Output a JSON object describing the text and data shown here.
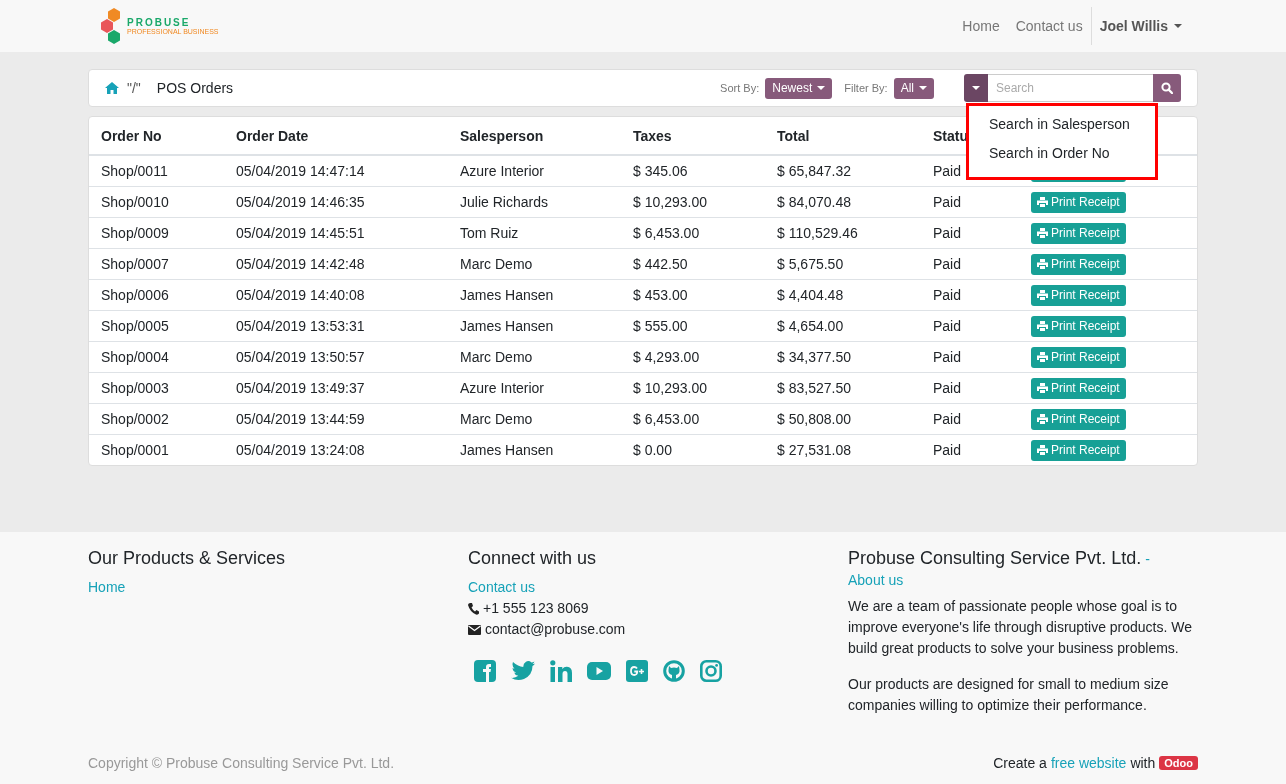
{
  "navbar": {
    "logo": {
      "name": "PROBUSE",
      "tagline": "PROFESSIONAL BUSINESS"
    },
    "links": [
      {
        "label": "Home"
      },
      {
        "label": "Contact us"
      }
    ],
    "user": "Joel Willis"
  },
  "toolbar": {
    "breadcrumb": [
      "\"/\"",
      "POS Orders"
    ],
    "sort_label": "Sort By:",
    "sort_value": "Newest",
    "filter_label": "Filter By:",
    "filter_value": "All",
    "search": {
      "placeholder": "Search"
    },
    "search_menu": {
      "expanded": true,
      "items": [
        "Search in Salesperson",
        "Search in Order No"
      ]
    }
  },
  "table": {
    "columns": [
      "Order No",
      "Order Date",
      "Salesperson",
      "Taxes",
      "Total",
      "Statu"
    ],
    "rows": [
      {
        "cells": [
          "Shop/0011",
          "05/04/2019 14:47:14",
          "Azure Interior",
          "$ 345.06",
          "$ 65,847.32",
          "Paid"
        ],
        "action": ""
      },
      {
        "cells": [
          "Shop/0010",
          "05/04/2019 14:46:35",
          "Julie Richards",
          "$ 10,293.00",
          "$ 84,070.48",
          "Paid"
        ],
        "action": "Print Receipt"
      },
      {
        "cells": [
          "Shop/0009",
          "05/04/2019 14:45:51",
          "Tom Ruiz",
          "$ 6,453.00",
          "$ 110,529.46",
          "Paid"
        ],
        "action": "Print Receipt"
      },
      {
        "cells": [
          "Shop/0007",
          "05/04/2019 14:42:48",
          "Marc Demo",
          "$ 442.50",
          "$ 5,675.50",
          "Paid"
        ],
        "action": "Print Receipt"
      },
      {
        "cells": [
          "Shop/0006",
          "05/04/2019 14:40:08",
          "James Hansen",
          "$ 453.00",
          "$ 4,404.48",
          "Paid"
        ],
        "action": "Print Receipt"
      },
      {
        "cells": [
          "Shop/0005",
          "05/04/2019 13:53:31",
          "James Hansen",
          "$ 555.00",
          "$ 4,654.00",
          "Paid"
        ],
        "action": "Print Receipt"
      },
      {
        "cells": [
          "Shop/0004",
          "05/04/2019 13:50:57",
          "Marc Demo",
          "$ 4,293.00",
          "$ 34,377.50",
          "Paid"
        ],
        "action": "Print Receipt"
      },
      {
        "cells": [
          "Shop/0003",
          "05/04/2019 13:49:37",
          "Azure Interior",
          "$ 10,293.00",
          "$ 83,527.50",
          "Paid"
        ],
        "action": "Print Receipt"
      },
      {
        "cells": [
          "Shop/0002",
          "05/04/2019 13:44:59",
          "Marc Demo",
          "$ 6,453.00",
          "$ 50,808.00",
          "Paid"
        ],
        "action": "Print Receipt"
      },
      {
        "cells": [
          "Shop/0001",
          "05/04/2019 13:24:08",
          "James Hansen",
          "$ 0.00",
          "$ 27,531.08",
          "Paid"
        ],
        "action": "Print Receipt"
      }
    ]
  },
  "footer": {
    "products": {
      "title": "Our Products & Services",
      "links": [
        "Home"
      ]
    },
    "connect": {
      "title": "Connect with us",
      "link": "Contact us",
      "phone": "+1 555 123 8069",
      "email": "contact@probuse.com"
    },
    "about": {
      "title": "Probuse Consulting Service Pvt. Ltd.",
      "dash": "-",
      "link": "About us",
      "paragraphs": [
        "We are a team of passionate people whose goal is to improve everyone's life through disruptive products. We build great products to solve your business problems.",
        "Our products are designed for small to medium size companies willing to optimize their performance."
      ]
    },
    "copyright": "Copyright © Probuse Consulting Service Pvt. Ltd.",
    "credit": {
      "before": "Create a",
      "link": "free website",
      "after": "with",
      "badge": "Odoo"
    }
  }
}
